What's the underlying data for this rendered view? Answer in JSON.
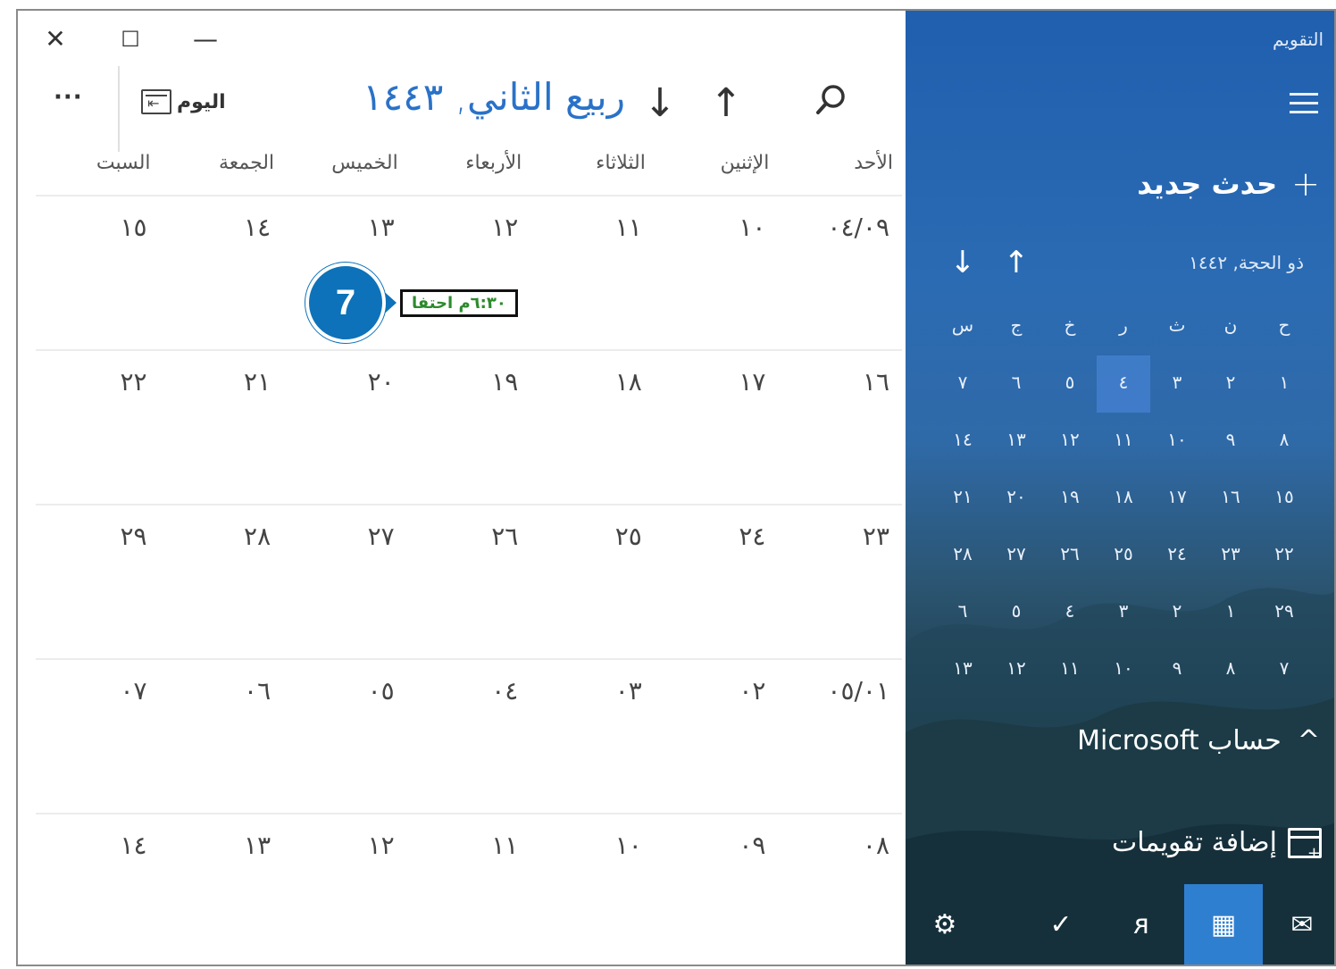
{
  "window_controls": {
    "close": "✕",
    "maximize": "☐",
    "minimize": "—"
  },
  "toolbar": {
    "more": "···",
    "today_label": "اليوم",
    "month_title": "ربيع الثاني, ١٤٤٣",
    "nav_down": "↓",
    "nav_up": "↑"
  },
  "day_headers": [
    "الأحد",
    "الإثنين",
    "الثلاثاء",
    "الأربعاء",
    "الخميس",
    "الجمعة",
    "السبت"
  ],
  "weeks": [
    [
      "٠٤/٠٩",
      "١٠",
      "١١",
      "١٢",
      "١٣",
      "١٤",
      "١٥"
    ],
    [
      "١٦",
      "١٧",
      "١٨",
      "١٩",
      "٢٠",
      "٢١",
      "٢٢"
    ],
    [
      "٢٣",
      "٢٤",
      "٢٥",
      "٢٦",
      "٢٧",
      "٢٨",
      "٢٩"
    ],
    [
      "٠٥/٠١",
      "٠٢",
      "٠٣",
      "٠٤",
      "٠٥",
      "٠٦",
      "٠٧"
    ],
    [
      "٠٨",
      "٠٩",
      "١٠",
      "١١",
      "١٢",
      "١٣",
      "١٤"
    ]
  ],
  "event": {
    "text": "٦:٣٠م احتفا",
    "step_badge": "7"
  },
  "sidebar": {
    "app_title": "التقويم",
    "new_event_plus": "+",
    "new_event_label": "حدث جديد",
    "mini_calendar": {
      "title": "ذو الحجة, ١٤٤٢",
      "nav_down": "↓",
      "nav_up": "↑",
      "day_initials": [
        "ح",
        "ن",
        "ث",
        "ر",
        "خ",
        "ج",
        "س"
      ],
      "rows": [
        [
          "١",
          "٢",
          "٣",
          "٤",
          "٥",
          "٦",
          "٧"
        ],
        [
          "٨",
          "٩",
          "١٠",
          "١١",
          "١٢",
          "١٣",
          "١٤"
        ],
        [
          "١٥",
          "١٦",
          "١٧",
          "١٨",
          "١٩",
          "٢٠",
          "٢١"
        ],
        [
          "٢٢",
          "٢٣",
          "٢٤",
          "٢٥",
          "٢٦",
          "٢٧",
          "٢٨"
        ],
        [
          "٢٩",
          "١",
          "٢",
          "٣",
          "٤",
          "٥",
          "٦"
        ],
        [
          "٧",
          "٨",
          "٩",
          "١٠",
          "١١",
          "١٢",
          "١٣"
        ]
      ]
    },
    "account_chevron": "^",
    "account_label": "حساب Microsoft",
    "add_calendars_label": "إضافة تقويمات",
    "bottom_icons": {
      "mail": "✉",
      "calendar": "▦",
      "people": "ᴙ",
      "todo": "✓",
      "settings": "⚙"
    }
  },
  "colors": {
    "accent": "#2a72c8",
    "badge": "#0d72b9",
    "event_text": "#2d8a2d",
    "sidebar_top": "#1f5fae"
  }
}
